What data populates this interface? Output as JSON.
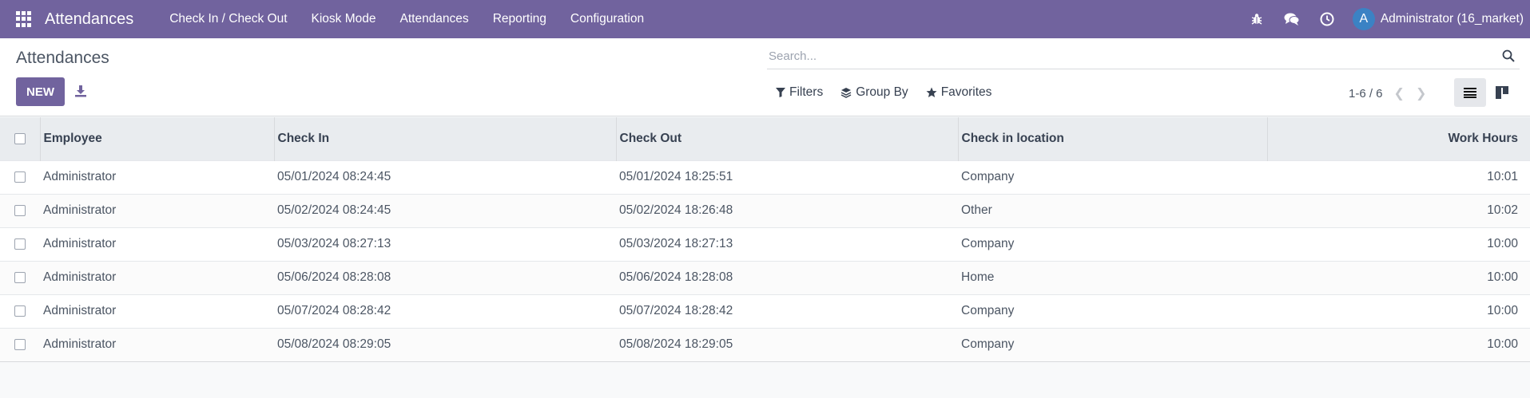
{
  "navbar": {
    "brand": "Attendances",
    "menu": [
      "Check In / Check Out",
      "Kiosk Mode",
      "Attendances",
      "Reporting",
      "Configuration"
    ],
    "user_initial": "A",
    "user_name": "Administrator (16_market)"
  },
  "page": {
    "title": "Attendances",
    "new_label": "NEW",
    "search_placeholder": "Search...",
    "filters_label": "Filters",
    "group_by_label": "Group By",
    "favorites_label": "Favorites",
    "pager_text": "1-6 / 6"
  },
  "table": {
    "columns": [
      "Employee",
      "Check In",
      "Check Out",
      "Check in location",
      "Work Hours"
    ],
    "rows": [
      [
        "Administrator",
        "05/01/2024 08:24:45",
        "05/01/2024 18:25:51",
        "Company",
        "10:01"
      ],
      [
        "Administrator",
        "05/02/2024 08:24:45",
        "05/02/2024 18:26:48",
        "Other",
        "10:02"
      ],
      [
        "Administrator",
        "05/03/2024 08:27:13",
        "05/03/2024 18:27:13",
        "Company",
        "10:00"
      ],
      [
        "Administrator",
        "05/06/2024 08:28:08",
        "05/06/2024 18:28:08",
        "Home",
        "10:00"
      ],
      [
        "Administrator",
        "05/07/2024 08:28:42",
        "05/07/2024 18:28:42",
        "Company",
        "10:00"
      ],
      [
        "Administrator",
        "05/08/2024 08:29:05",
        "05/08/2024 18:29:05",
        "Company",
        "10:00"
      ]
    ]
  },
  "colors": {
    "primary": "#71639e",
    "avatar": "#3b82c4"
  }
}
